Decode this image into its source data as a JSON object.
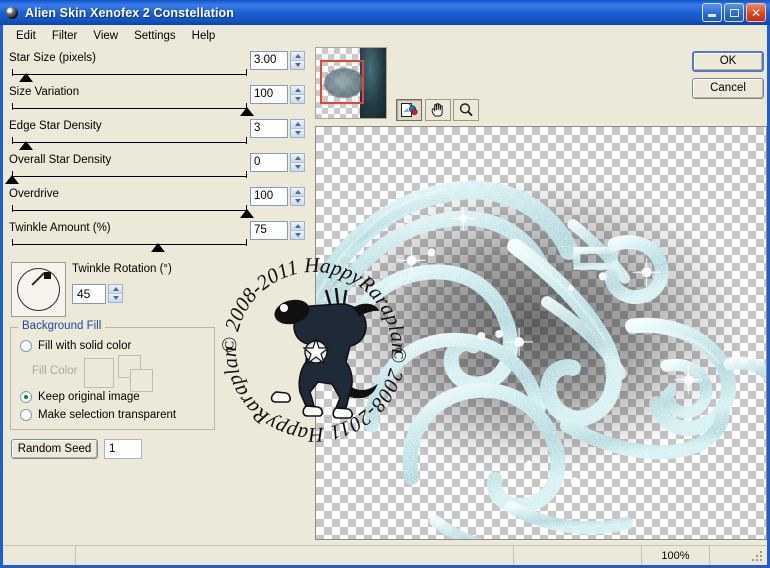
{
  "window": {
    "title": "Alien Skin Xenofex 2 Constellation",
    "icon": "app-ball-icon",
    "buttons": {
      "minimize": "minimize-icon",
      "maximize": "maximize-icon",
      "close": "close-icon"
    }
  },
  "menubar": {
    "items": [
      "Edit",
      "Filter",
      "View",
      "Settings",
      "Help"
    ]
  },
  "sliders": [
    {
      "label": "Star Size (pixels)",
      "value": "3.00",
      "thumb_pct": 6
    },
    {
      "label": "Size Variation",
      "value": "100",
      "thumb_pct": 100
    },
    {
      "label": "Edge Star Density",
      "value": "3",
      "thumb_pct": 6
    },
    {
      "label": "Overall Star Density",
      "value": "0",
      "thumb_pct": 0
    },
    {
      "label": "Overdrive",
      "value": "100",
      "thumb_pct": 100
    },
    {
      "label": "Twinkle Amount (%)",
      "value": "75",
      "thumb_pct": 62
    }
  ],
  "rotation": {
    "label": "Twinkle Rotation (°)",
    "value": "45",
    "dial_degrees": 45
  },
  "background_fill": {
    "title": "Background Fill",
    "fill_color_label": "Fill Color",
    "options": [
      {
        "label": "Fill with solid color",
        "selected": false
      },
      {
        "label": "Keep original image",
        "selected": true
      },
      {
        "label": "Make selection transparent",
        "selected": false
      }
    ]
  },
  "random_seed": {
    "button_label": "Random Seed",
    "value": "1"
  },
  "toolbar": {
    "tools": [
      {
        "name": "preview-compare-icon",
        "pressed": true
      },
      {
        "name": "hand-pan-icon",
        "pressed": false
      },
      {
        "name": "zoom-magnifier-icon",
        "pressed": false
      }
    ]
  },
  "actions": {
    "ok_label": "OK",
    "cancel_label": "Cancel"
  },
  "statusbar": {
    "cells": [
      "",
      "",
      "",
      "100%",
      ""
    ],
    "zoom": "100%"
  },
  "watermark": {
    "top_text": "HappyRaraplan",
    "bottom_text": "© 2008-2011"
  },
  "colors": {
    "titlebar_blue": "#1e5fd0",
    "dialog_face": "#ece9d8",
    "group_title_blue": "#1b4a9c",
    "radio_green": "#0a8a2a",
    "selection_red": "#e8433a",
    "glitter_teal": "#9fdbe0"
  }
}
